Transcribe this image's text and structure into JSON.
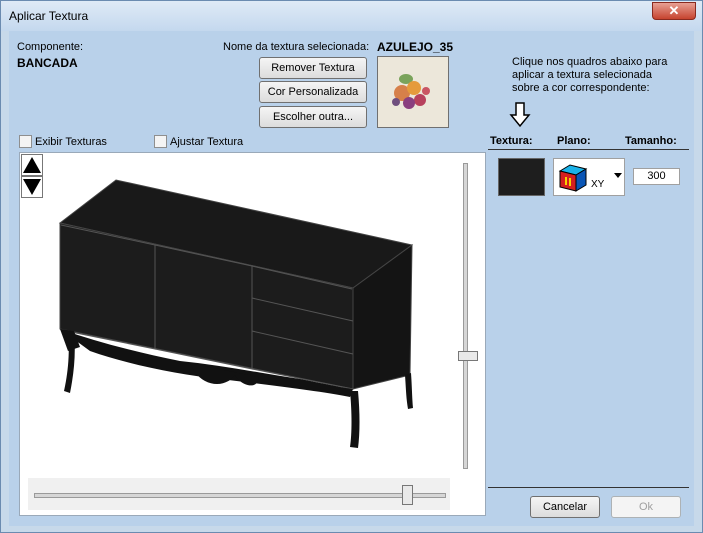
{
  "window": {
    "title": "Aplicar Textura",
    "close_glyph": "✕"
  },
  "component": {
    "label": "Componente:",
    "value": "BANCADA"
  },
  "texture": {
    "label": "Nome da textura selecionada:",
    "name": "AZULEJO_35"
  },
  "buttons": {
    "remove": "Remover Textura",
    "custom_color": "Cor Personalizada",
    "choose_other": "Escolher outra...",
    "cancel": "Cancelar",
    "ok": "Ok"
  },
  "instructions": {
    "line1": "Clique nos quadros abaixo para",
    "line2": "aplicar a textura selecionada",
    "line3": "sobre a cor correspondente:"
  },
  "checkboxes": {
    "show_textures": "Exibir Texturas",
    "adjust_texture": "Ajustar Textura"
  },
  "panel": {
    "col_texture": "Textura:",
    "col_plane": "Plano:",
    "col_size": "Tamanho:"
  },
  "row": {
    "plane_value": "XY",
    "size_value": "300",
    "swatch_color": "#1e1e1e"
  },
  "sliders": {
    "vertical_level": 0.63,
    "horizontal_level": 0.91
  },
  "icons": {
    "arrow_down_hint": "arrow-down-outline-icon",
    "plane_icon": "cube-plane-icon",
    "dropdown": "chevron-down-icon",
    "up": "arrow-up-icon",
    "down": "arrow-down-icon"
  }
}
